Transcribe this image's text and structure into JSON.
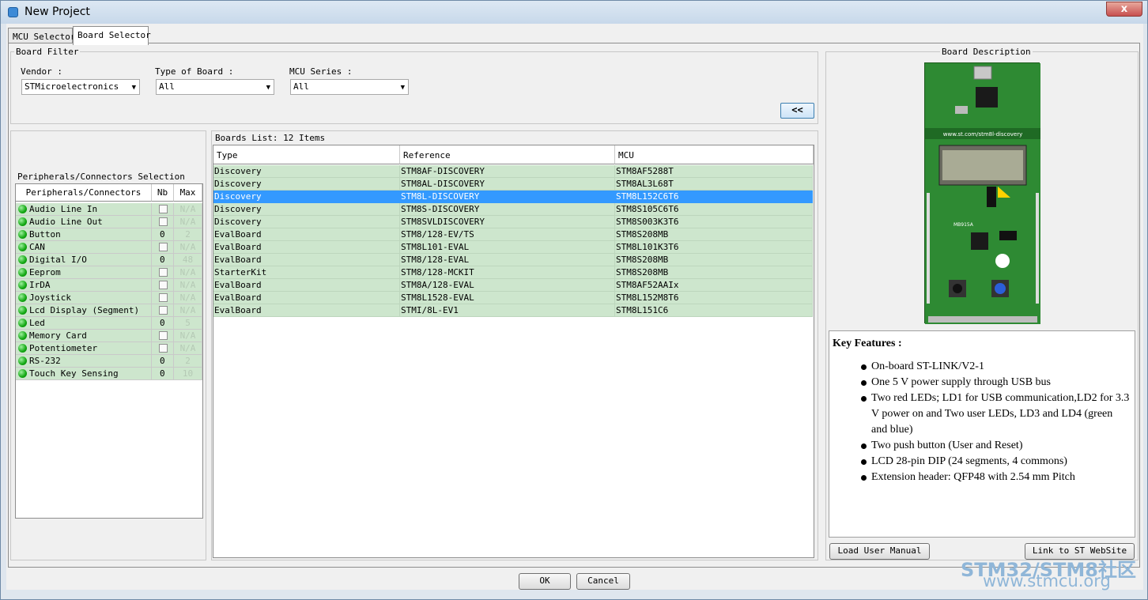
{
  "window": {
    "title": "New Project",
    "close_label": "x"
  },
  "tabs": [
    {
      "label": "MCU Selector"
    },
    {
      "label": "Board Selector"
    }
  ],
  "board_filter": {
    "legend": "Board Filter",
    "vendor_label": "Vendor :",
    "vendor_value": "STMicroelectronics",
    "type_label": "Type of Board :",
    "type_value": "All",
    "series_label": "MCU Series :",
    "series_value": "All",
    "collapse_label": "<<"
  },
  "peripherals": {
    "legend": "Peripherals/Connectors Selection",
    "headers": {
      "name": "Peripherals/Connectors",
      "nb": "Nb",
      "max": "Max"
    },
    "rows": [
      {
        "name": "Audio Line In",
        "nb": "",
        "max": "N/A"
      },
      {
        "name": "Audio Line Out",
        "nb": "",
        "max": "N/A"
      },
      {
        "name": "Button",
        "nb": "0",
        "max": "2"
      },
      {
        "name": "CAN",
        "nb": "",
        "max": "N/A"
      },
      {
        "name": "Digital I/O",
        "nb": "0",
        "max": "48"
      },
      {
        "name": "Eeprom",
        "nb": "",
        "max": "N/A"
      },
      {
        "name": "IrDA",
        "nb": "",
        "max": "N/A"
      },
      {
        "name": "Joystick",
        "nb": "",
        "max": "N/A"
      },
      {
        "name": "Lcd Display (Segment)",
        "nb": "",
        "max": "N/A"
      },
      {
        "name": "Led",
        "nb": "0",
        "max": "5"
      },
      {
        "name": "Memory Card",
        "nb": "",
        "max": "N/A"
      },
      {
        "name": "Potentiometer",
        "nb": "",
        "max": "N/A"
      },
      {
        "name": "RS-232",
        "nb": "0",
        "max": "2"
      },
      {
        "name": "Touch Key Sensing",
        "nb": "0",
        "max": "10"
      }
    ]
  },
  "boards": {
    "legend": "Boards List: 12 Items",
    "headers": {
      "type": "Type",
      "reference": "Reference",
      "mcu": "MCU"
    },
    "rows": [
      {
        "type": "Discovery",
        "reference": "STM8AF-DISCOVERY",
        "mcu": "STM8AF5288T"
      },
      {
        "type": "Discovery",
        "reference": "STM8AL-DISCOVERY",
        "mcu": "STM8AL3L68T"
      },
      {
        "type": "Discovery",
        "reference": "STM8L-DISCOVERY",
        "mcu": "STM8L152C6T6",
        "selected": true
      },
      {
        "type": "Discovery",
        "reference": "STM8S-DISCOVERY",
        "mcu": "STM8S105C6T6"
      },
      {
        "type": "Discovery",
        "reference": "STM8SVLDISCOVERY",
        "mcu": "STM8S003K3T6"
      },
      {
        "type": "EvalBoard",
        "reference": "STM8/128-EV/TS",
        "mcu": "STM8S208MB"
      },
      {
        "type": "EvalBoard",
        "reference": "STM8L101-EVAL",
        "mcu": "STM8L101K3T6"
      },
      {
        "type": "EvalBoard",
        "reference": "STM8/128-EVAL",
        "mcu": "STM8S208MB"
      },
      {
        "type": "StarterKit",
        "reference": "STM8/128-MCKIT",
        "mcu": "STM8S208MB"
      },
      {
        "type": "EvalBoard",
        "reference": "STM8A/128-EVAL",
        "mcu": "STM8AF52AAIx"
      },
      {
        "type": "EvalBoard",
        "reference": "STM8L1528-EVAL",
        "mcu": "STM8L152M8T6"
      },
      {
        "type": "EvalBoard",
        "reference": "STMI/8L-EV1",
        "mcu": "STM8L151C6"
      }
    ]
  },
  "description": {
    "legend": "Board Description",
    "features_title": "Key Features :",
    "features": [
      "On-board ST-LINK/V2-1",
      "One 5 V power supply through USB bus",
      "Two red LEDs; LD1 for USB communication,LD2 for 3.3 V power on and Two user LEDs, LD3 and LD4 (green and blue)",
      "Two push button (User and Reset)",
      "LCD 28-pin DIP (24 segments, 4 commons)",
      "Extension header: QFP48 with 2.54 mm Pitch"
    ],
    "board_silk_url": "www.st.com/stm8l-discovery",
    "board_silk_model": "MB915A",
    "load_manual_label": "Load User Manual",
    "link_label": "Link to ST WebSite"
  },
  "footer": {
    "ok_label": "OK",
    "cancel_label": "Cancel"
  },
  "watermark": {
    "line1": "STM32/STM8社区",
    "line2": "www.stmcu.org"
  }
}
